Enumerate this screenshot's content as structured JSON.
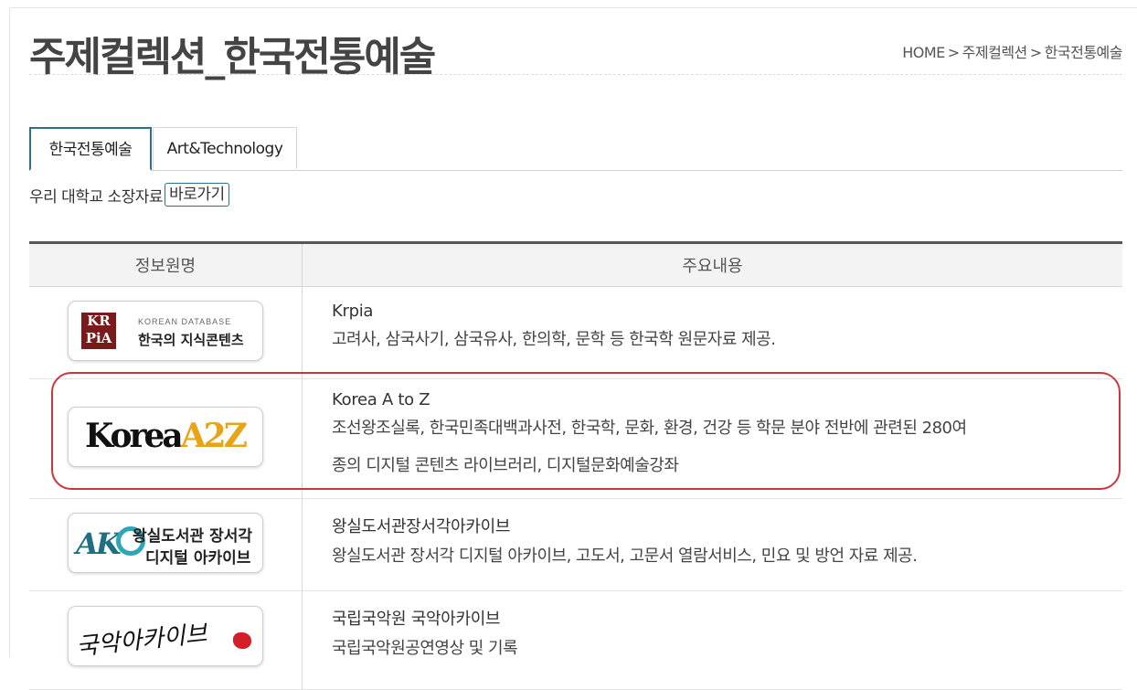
{
  "page": {
    "title": "주제컬렉션_한국전통예술",
    "breadcrumb": [
      "HOME",
      "주제컬렉션",
      "한국전통예술"
    ],
    "breadcrumb_separator": ">"
  },
  "tabs": [
    {
      "label": "한국전통예술",
      "active": true
    },
    {
      "label": "Art&Technology",
      "active": false
    }
  ],
  "description": {
    "text": "우리 대학교 소장자료",
    "button_label": "바로가기"
  },
  "table": {
    "headers": [
      "정보원명",
      "주요내용"
    ],
    "rows": [
      {
        "logo": {
          "kind": "krpia",
          "box_text": "KR\nPia",
          "small_text": "KOREAN DATABASE",
          "big_text": "한국의 지식콘텐츠"
        },
        "name": "Krpia",
        "lines": [
          "고려사, 삼국사기, 삼국유사, 한의학, 문학 등 한국학 원문자료 제공."
        ]
      },
      {
        "logo": {
          "kind": "a2z",
          "text_main": "Korea",
          "text_accent": "A2Z"
        },
        "name": "Korea A to Z",
        "lines": [
          "조선왕조실록, 한국민족대백과사전, 한국학, 문화, 환경, 건강 등 학문 분야 전반에 관련된 280여",
          "종의 디지털 콘텐츠 라이브러리, 디지털문화예술강좌"
        ],
        "highlighted": true
      },
      {
        "logo": {
          "kind": "ako",
          "mark": "AK",
          "line1": "왕실도서관 장서각",
          "line2": "디지털 아카이브"
        },
        "name": "왕실도서관장서각아카이브",
        "lines": [
          "왕실도서관 장서각 디지털 아카이브, 고도서, 고문서 열람서비스, 민요 및 방언 자료 제공."
        ]
      },
      {
        "logo": {
          "kind": "gugak",
          "text": "국악아카이브"
        },
        "name": "국립국악원 국악아카이브",
        "lines": [
          "국립국악원공연영상 및 기록"
        ]
      }
    ]
  },
  "colors": {
    "tab_active_border": "#2f6f86",
    "highlight_border": "#c9363e",
    "table_top_border": "#555555",
    "header_bg": "#f3f3f3",
    "a2z_accent": "#e8a317",
    "krpia_box": "#7a1b1b",
    "ako_teal": "#1f6f83",
    "gugak_seal": "#d21f2a"
  }
}
